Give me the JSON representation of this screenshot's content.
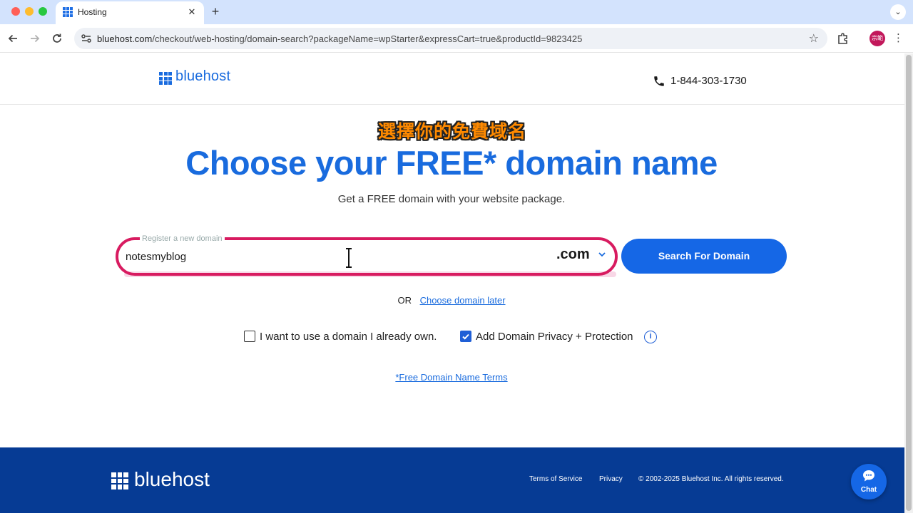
{
  "browser": {
    "tab_title": "Hosting",
    "tab_close": "✕",
    "new_tab": "+",
    "tabstrip_menu": "⌄",
    "url_host": "bluehost.com",
    "url_path": "/checkout/web-hosting/domain-search?packageName=wpStarter&expressCart=true&productId=9823425",
    "profile_initials": "宗範"
  },
  "header": {
    "logo_text": "bluehost",
    "phone": "1-844-303-1730"
  },
  "hero": {
    "annotation": "選擇你的免費域名",
    "title": "Choose your FREE* domain name",
    "subtitle": "Get a FREE domain with your website package."
  },
  "search": {
    "label": "Register a new domain",
    "value": "notesmyblog",
    "tld": ".com",
    "button": "Search For Domain"
  },
  "alt": {
    "or_text": "OR",
    "later_link": "Choose domain later"
  },
  "options": {
    "own_domain_label": "I want to use a domain I already own.",
    "own_domain_checked": false,
    "privacy_label": "Add Domain Privacy + Protection",
    "privacy_checked": true,
    "info_glyph": "i"
  },
  "terms_link": "*Free Domain Name Terms",
  "footer": {
    "logo_text": "bluehost",
    "terms": "Terms of Service",
    "privacy": "Privacy",
    "copyright": "© 2002-2025 Bluehost Inc. All rights reserved.",
    "chat": "Chat"
  },
  "colors": {
    "brand_blue": "#196bde",
    "button_blue": "#1567e6",
    "footer_blue": "#063b94",
    "highlight_pink": "#d81b60",
    "annotation_orange": "#ff8a00"
  }
}
